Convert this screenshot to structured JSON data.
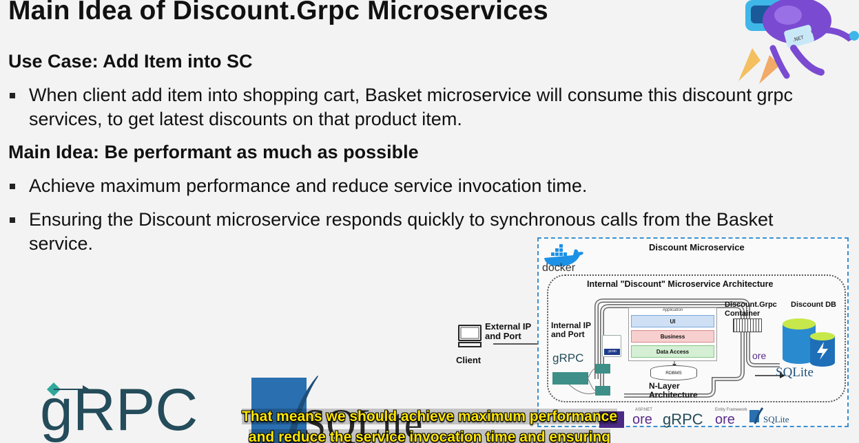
{
  "slide": {
    "title": "Main Idea of Discount.Grpc Microservices",
    "use_case_heading": "Use Case: Add Item into SC",
    "use_case_bullets": [
      "When client add item into shopping cart, Basket microservice will consume this discount grpc services, to get latest discounts on that product item."
    ],
    "main_idea_heading": "Main Idea: Be performant as much as possible",
    "main_idea_bullets": [
      "Achieve maximum performance and reduce service invocation time.",
      "Ensuring the Discount microservice responds quickly to synchronous calls from the Basket service."
    ]
  },
  "diagram": {
    "title": "Discount Microservice",
    "docker_label": "docker",
    "inner_title": "Internal \"Discount\" Microservice Architecture",
    "internal_ip": "Internal IP\nand Port",
    "container_label": "Discount.Grpc\nContainer",
    "db_label": "Discount DB",
    "layers_caption": "Application",
    "layers": [
      {
        "label": "UI",
        "color": "#cfe0f5",
        "border": "#7aa6d8"
      },
      {
        "label": "Business",
        "color": "#f7cfcf",
        "border": "#d88a8a"
      },
      {
        "label": "Data Access",
        "color": "#d4efd4",
        "border": "#85c385"
      }
    ],
    "rdbms_label": "RDBMS",
    "architecture_label": "N-Layer\nArchitecture",
    "proto_label": ".proto",
    "grpc_small": "gRPC",
    "sqlite_small": "SQLite",
    "core_label": "ore",
    "bottom_logos": {
      "aspnet_caption": "ASP.NET",
      "core": "ore",
      "grpc": "gRPC",
      "ef_caption": "Entity Framework",
      "ef_core": "ore",
      "sqlite": "SQLite"
    }
  },
  "client": {
    "label": "Client",
    "external_ip": "External IP\nand Port"
  },
  "logos": {
    "grpc_big": "gRPC",
    "sqlite_big": "SQLite"
  },
  "subtitles": {
    "line1": "That means we should achieve maximum performance",
    "line2": "and reduce the service invocation time and ensuring"
  },
  "colors": {
    "grpc_teal": "#244c5a",
    "grpc_accent": "#2ea89a",
    "diagram_border": "#3a8fd0",
    "subtitle": "#ffe600",
    "sqlite_blue": "#1e4f7a"
  }
}
